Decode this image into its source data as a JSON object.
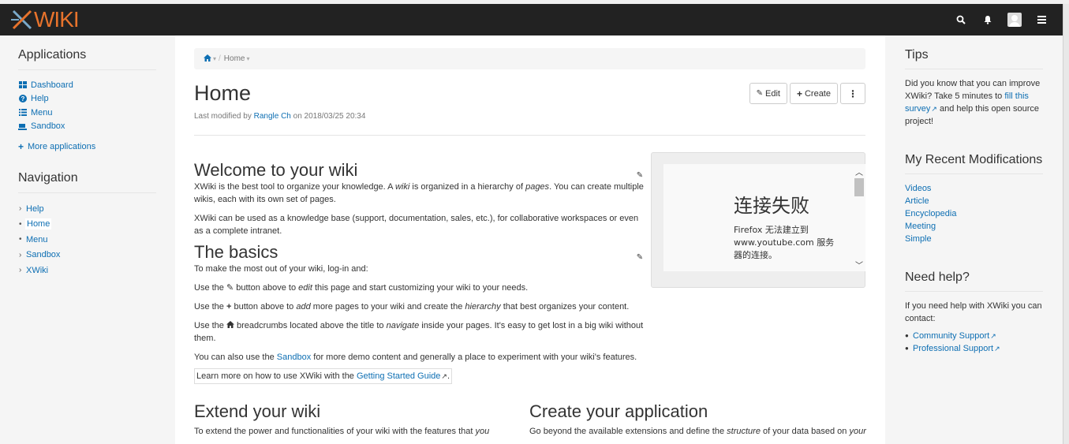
{
  "brand": {
    "logo_text": "WIKI",
    "accent": "#e8732c"
  },
  "navbar": {
    "icons": [
      "search-icon",
      "bell-icon",
      "avatar",
      "hamburger-menu-icon"
    ]
  },
  "left_panel": {
    "applications": {
      "title": "Applications",
      "items": [
        {
          "label": "Dashboard",
          "icon": "dashboard-icon"
        },
        {
          "label": "Help",
          "icon": "question-icon"
        },
        {
          "label": "Menu",
          "icon": "list-icon"
        },
        {
          "label": "Sandbox",
          "icon": "sandbox-icon"
        }
      ],
      "more": "More applications"
    },
    "navigation": {
      "title": "Navigation",
      "items": [
        {
          "label": "Help",
          "marker": "›"
        },
        {
          "label": "Home",
          "marker": "•",
          "current": true
        },
        {
          "label": "Menu",
          "marker": "•"
        },
        {
          "label": "Sandbox",
          "marker": "›"
        },
        {
          "label": "XWiki",
          "marker": "›"
        }
      ]
    }
  },
  "breadcrumb": {
    "current": "Home"
  },
  "page": {
    "title": "Home",
    "lastmod_prefix": "Last modified by",
    "author": "Rangle Ch",
    "lastmod_suffix": "on 2018/03/25 20:34",
    "buttons": {
      "edit": "Edit",
      "create": "Create"
    }
  },
  "content": {
    "welcome": {
      "title": "Welcome to your wiki",
      "p1_a": "XWiki is the best tool to organize your knowledge. A ",
      "p1_em1": "wiki",
      "p1_b": " is organized in a hierarchy of ",
      "p1_em2": "pages",
      "p1_c": ". You can create multiple wikis, each with its own set of pages.",
      "p2": "XWiki can be used as a knowledge base (support, documentation, sales, etc.), for collaborative workspaces or even as a complete intranet."
    },
    "basics": {
      "title": "The basics",
      "intro": "To make the most out of your wiki, log-in and:",
      "l1_a": "Use the ",
      "l1_b": " button above to ",
      "l1_em": "edit",
      "l1_c": " this page and start customizing your wiki to your needs.",
      "l2_a": "Use the ",
      "l2_b": " button above to ",
      "l2_em": "add",
      "l2_c": " more pages to your wiki and create the ",
      "l2_em2": "hierarchy",
      "l2_d": " that best organizes your content.",
      "l3_a": "Use the ",
      "l3_b": " breadcrumbs located above the title to ",
      "l3_em": "navigate",
      "l3_c": " inside your pages. It's easy to get lost in a big wiki without them.",
      "l4_a": "You can also use the ",
      "l4_link": "Sandbox",
      "l4_b": " for more demo content and generally a place to experiment with your wiki's features.",
      "guide_a": "Learn more on how to use XWiki with the ",
      "guide_link": "Getting Started Guide",
      "guide_b": "."
    },
    "iframe": {
      "error_title": "连接失败",
      "error_msg": "Firefox 无法建立到 www.youtube.com 服务器的连接。"
    },
    "extend": {
      "title": "Extend your wiki",
      "text_a": "To extend the power and functionalities of your wiki with the features that ",
      "text_em": "you"
    },
    "create": {
      "title": "Create your application",
      "text_a": "Go beyond the available extensions and define the ",
      "text_em": "structure",
      "text_b": " of your data based on ",
      "text_em2": "your"
    }
  },
  "right_panel": {
    "tips": {
      "title": "Tips",
      "text_a": "Did you know that you can improve XWiki? Take 5 minutes to ",
      "link": "fill this survey",
      "text_b": " and help this open source project!"
    },
    "recent": {
      "title": "My Recent Modifications",
      "items": [
        "Videos",
        "Article",
        "Encyclopedia",
        "Meeting",
        "Simple"
      ]
    },
    "help": {
      "title": "Need help?",
      "text": "If you need help with XWiki you can contact:",
      "items": [
        "Community Support",
        "Professional Support"
      ]
    }
  }
}
